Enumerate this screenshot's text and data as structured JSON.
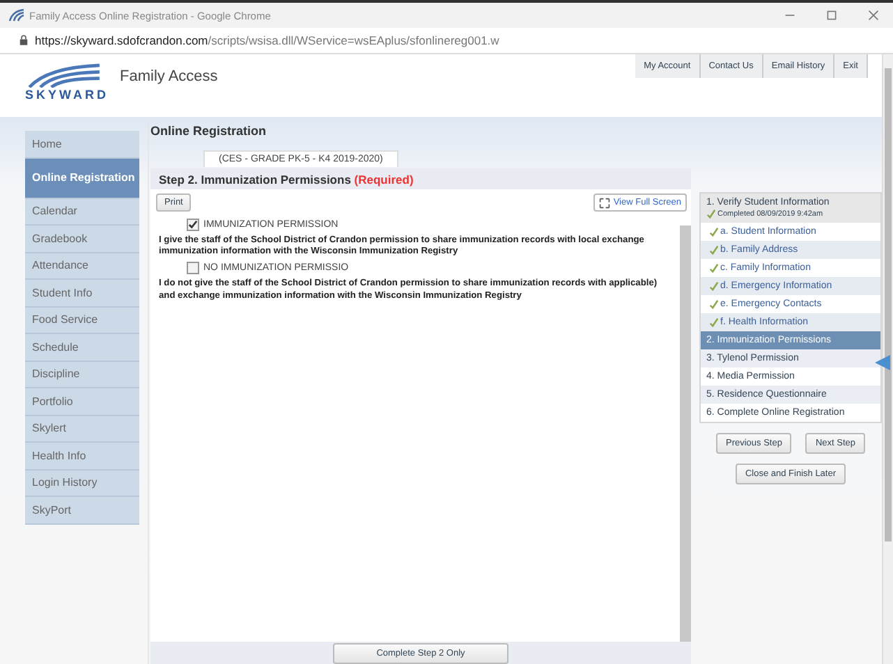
{
  "window": {
    "title": "Family Access Online Registration - Google Chrome",
    "url_host": "https://skyward.sdofcrandon.com",
    "url_path": "/scripts/wsisa.dll/WService=wsEAplus/sfonlinereg001.w"
  },
  "header": {
    "logo": "SKYWARD",
    "app_name": "Family Access",
    "links": [
      "My Account",
      "Contact Us",
      "Email History",
      "Exit"
    ]
  },
  "sidebar": {
    "items": [
      {
        "label": "Home",
        "selected": false
      },
      {
        "label": "Online Registration",
        "selected": true
      },
      {
        "label": "Calendar",
        "selected": false
      },
      {
        "label": "Gradebook",
        "selected": false
      },
      {
        "label": "Attendance",
        "selected": false
      },
      {
        "label": "Student Info",
        "selected": false
      },
      {
        "label": "Food Service",
        "selected": false
      },
      {
        "label": "Schedule",
        "selected": false
      },
      {
        "label": "Discipline",
        "selected": false
      },
      {
        "label": "Portfolio",
        "selected": false
      },
      {
        "label": "Skylert",
        "selected": false
      },
      {
        "label": "Health Info",
        "selected": false
      },
      {
        "label": "Login History",
        "selected": false
      },
      {
        "label": "SkyPort",
        "selected": false
      }
    ]
  },
  "page_title": "Online Registration",
  "student_tab": "(CES - GRADE PK-5 - K4 2019-2020)",
  "step": {
    "title": "Step 2. Immunization Permissions",
    "required": "(Required)",
    "print": "Print",
    "full_screen": "View Full Screen",
    "options": [
      {
        "label": "IMMUNIZATION PERMISSION",
        "checked": true,
        "text": "I give the staff of the School District of Crandon permission to share immunization records with local exchange immunization information with the Wisconsin Immunization Registry"
      },
      {
        "label": "NO IMMUNIZATION PERMISSIO",
        "checked": false,
        "text": "I do not give the staff of the School District of Crandon permission to share immunization records with applicable) and exchange immunization information with the Wisconsin Immunization Registry"
      }
    ],
    "complete_button": "Complete Step 2 Only"
  },
  "steps": [
    {
      "label": "1. Verify Student Information",
      "note": "Completed 08/09/2019 9:42am",
      "selected": false,
      "children": [
        {
          "label": "a. Student Information",
          "checked": true
        },
        {
          "label": "b. Family Address",
          "checked": true
        },
        {
          "label": "c. Family Information",
          "checked": true
        },
        {
          "label": "d. Emergency Information",
          "checked": true
        },
        {
          "label": "e. Emergency Contacts",
          "checked": true
        },
        {
          "label": "f. Health Information",
          "checked": true
        }
      ]
    },
    {
      "label": "2. Immunization Permissions",
      "selected": true
    },
    {
      "label": "3. Tylenol Permission",
      "selected": false
    },
    {
      "label": "4. Media Permission",
      "selected": false
    },
    {
      "label": "5. Residence Questionnaire",
      "selected": false
    },
    {
      "label": "6. Complete Online Registration",
      "selected": false
    }
  ],
  "step_buttons": [
    "Previous Step",
    "Next Step",
    "Close and Finish Later"
  ]
}
